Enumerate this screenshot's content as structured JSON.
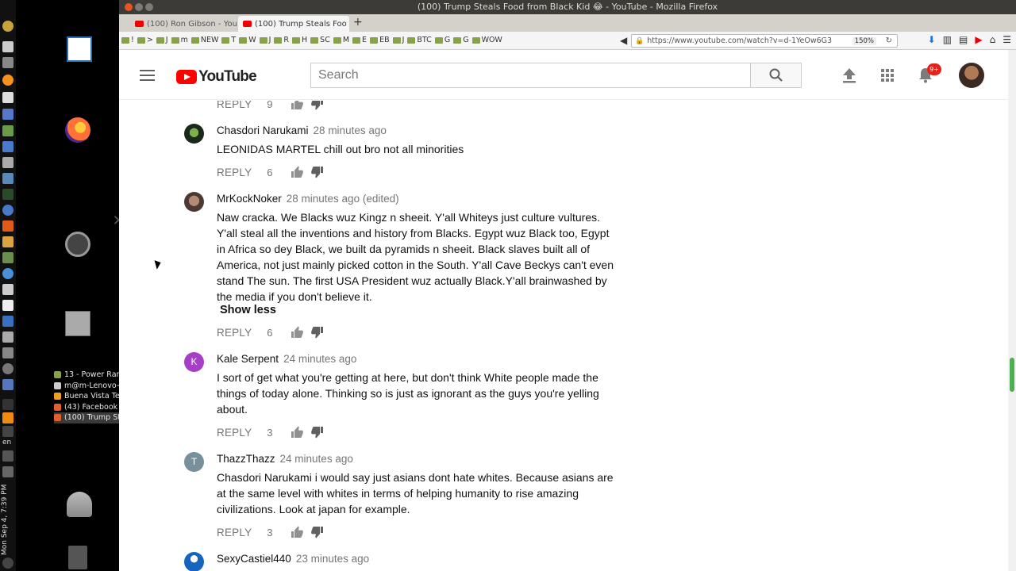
{
  "desktop": {
    "clock": "Mon Sep 4, 7:39 PM",
    "language": "en",
    "windows": [
      {
        "label": "13 - Power Ran...",
        "color": "#8aa14b"
      },
      {
        "label": "m@m-Lenovo-...",
        "color": "#cccccc"
      },
      {
        "label": "Buena Vista Te...",
        "color": "#f0a020"
      },
      {
        "label": "(43) Facebook -...",
        "color": "#e06030"
      },
      {
        "label": "(100) Trump St...",
        "color": "#e06030"
      }
    ]
  },
  "browser": {
    "window_title": "(100) Trump Steals Food from Black Kid 😂 - YouTube - Mozilla Firefox",
    "tabs": [
      {
        "label": "(100) Ron Gibson - You"
      },
      {
        "label": "(100) Trump Steals Foo"
      }
    ],
    "bookmarks": [
      "!",
      ">",
      "J",
      "m",
      "NEW",
      "T",
      "W",
      "J",
      "R",
      "H",
      "SC",
      "M",
      "E",
      "EB",
      "J",
      "BTC",
      "G",
      "G",
      "WOW"
    ],
    "url": "https://www.youtube.com/watch?v=d-1YeOw6G3",
    "zoom": "150%"
  },
  "youtube": {
    "logo_text": "YouTube",
    "search_placeholder": "Search",
    "notifications_badge": "9+"
  },
  "comments": {
    "top_reply": {
      "reply_label": "REPLY",
      "likes": "9"
    },
    "items": [
      {
        "author": "Chasdori Narukami",
        "time": "28 minutes ago",
        "text": "LEONIDAS MARTEL chill out bro not all minorities",
        "reply_label": "REPLY",
        "likes": "6"
      },
      {
        "author": "MrKockNoker",
        "time": "28 minutes ago (edited)",
        "text": "Naw cracka. We Blacks wuz Kingz n sheeit. Y'all Whiteys just culture vultures. Y'all steal all the inventions and history from Blacks. Egypt wuz Black too, Egypt in Africa so dey Black, we built da pyramids n sheeit. Black slaves built all of America, not just mainly picked cotton in the South. Y'all Cave Beckys can't even stand The sun. The first USA President wuz actually Black.Y'all brainwashed by the media if you don't believe it.",
        "show_less": "Show less",
        "reply_label": "REPLY",
        "likes": "6"
      },
      {
        "author": "Kale Serpent",
        "avatar_letter": "K",
        "avatar_color": "#a53fc6",
        "time": "24 minutes ago",
        "text": "I sort of get what you're getting at here, but don't think White people made the things of today alone. Thinking so is just as ignorant as the guys you're yelling about.",
        "reply_label": "REPLY",
        "likes": "3"
      },
      {
        "author": "ThazzThazz",
        "avatar_letter": "T",
        "avatar_color": "#78909c",
        "time": "24 minutes ago",
        "text": "Chasdori Narukami i would say just asians dont hate whites. Because asians are at the same level with whites in terms of helping humanity to rise amazing civilizations. Look at japan for example.",
        "reply_label": "REPLY",
        "likes": "3"
      },
      {
        "author": "SexyCastiel440",
        "time": "23 minutes ago"
      }
    ]
  }
}
